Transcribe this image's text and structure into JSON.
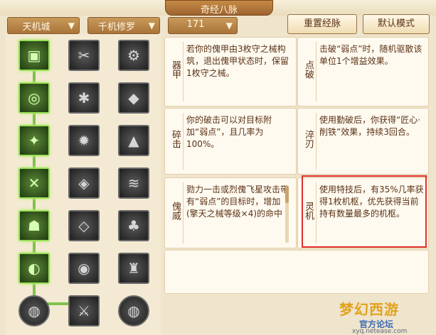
{
  "window": {
    "title": "奇经八脉"
  },
  "toolbar": {
    "school_select": "天机城",
    "branch_select": "千机修罗",
    "level_select": "171",
    "reset_button": "重置经脉",
    "default_button": "默认模式"
  },
  "grid": {
    "icons": [
      "book-icon",
      "scissors-icon",
      "gear-icon",
      "ring-icon",
      "claw-icon",
      "rock-icon",
      "bolt-icon",
      "flame-icon",
      "anvil-icon",
      "sword-icon",
      "cube-icon",
      "slash-icon",
      "mask-icon",
      "shield-icon",
      "tree-icon",
      "swirl-icon",
      "spiral-icon",
      "armor-icon",
      "orb-icon",
      "sword-emblem-icon",
      "orb-icon"
    ],
    "glyphs": [
      "▣",
      "✂",
      "⚙",
      "◎",
      "✱",
      "◆",
      "✦",
      "✹",
      "▲",
      "✕",
      "◈",
      "≋",
      "☗",
      "◇",
      "♣",
      "◐",
      "◉",
      "♜",
      "◍",
      "⚔",
      "◍"
    ],
    "active": [
      true,
      false,
      false,
      true,
      false,
      false,
      true,
      false,
      false,
      true,
      false,
      false,
      true,
      false,
      false,
      true,
      false,
      false,
      false,
      false,
      false
    ]
  },
  "cards": [
    {
      "label": "器甲",
      "desc": "若你的傀甲由3枚守之械构筑，退出傀甲状态时，保留1枚守之械。"
    },
    {
      "label": "点破",
      "desc": "击破“弱点”时，随机驱散该单位1个增益效果。"
    },
    {
      "label": "碎击",
      "desc": "你的破击可以对目标附加“弱点”，且几率为100%。"
    },
    {
      "label": "淬刃",
      "desc": "使用勤破后，你获得“匠心·削铁”效果，持续3回合。"
    },
    {
      "label": "傀威",
      "desc": "勠力一击或烈傀飞星攻击带有“弱点”的目标时，增加(擎天之械等级×4)的命中"
    },
    {
      "label": "灵机",
      "desc": "使用特技后，有35%几率获得1枚机枢，优先获得当前持有数量最多的机枢。"
    }
  ],
  "logo": {
    "name": "梦幻西游",
    "sub": "官方论坛",
    "url": "xyq.netease.com"
  },
  "colors": {
    "active_node": "#7ec24a",
    "highlight": "#e03030",
    "text": "#5a3216"
  }
}
